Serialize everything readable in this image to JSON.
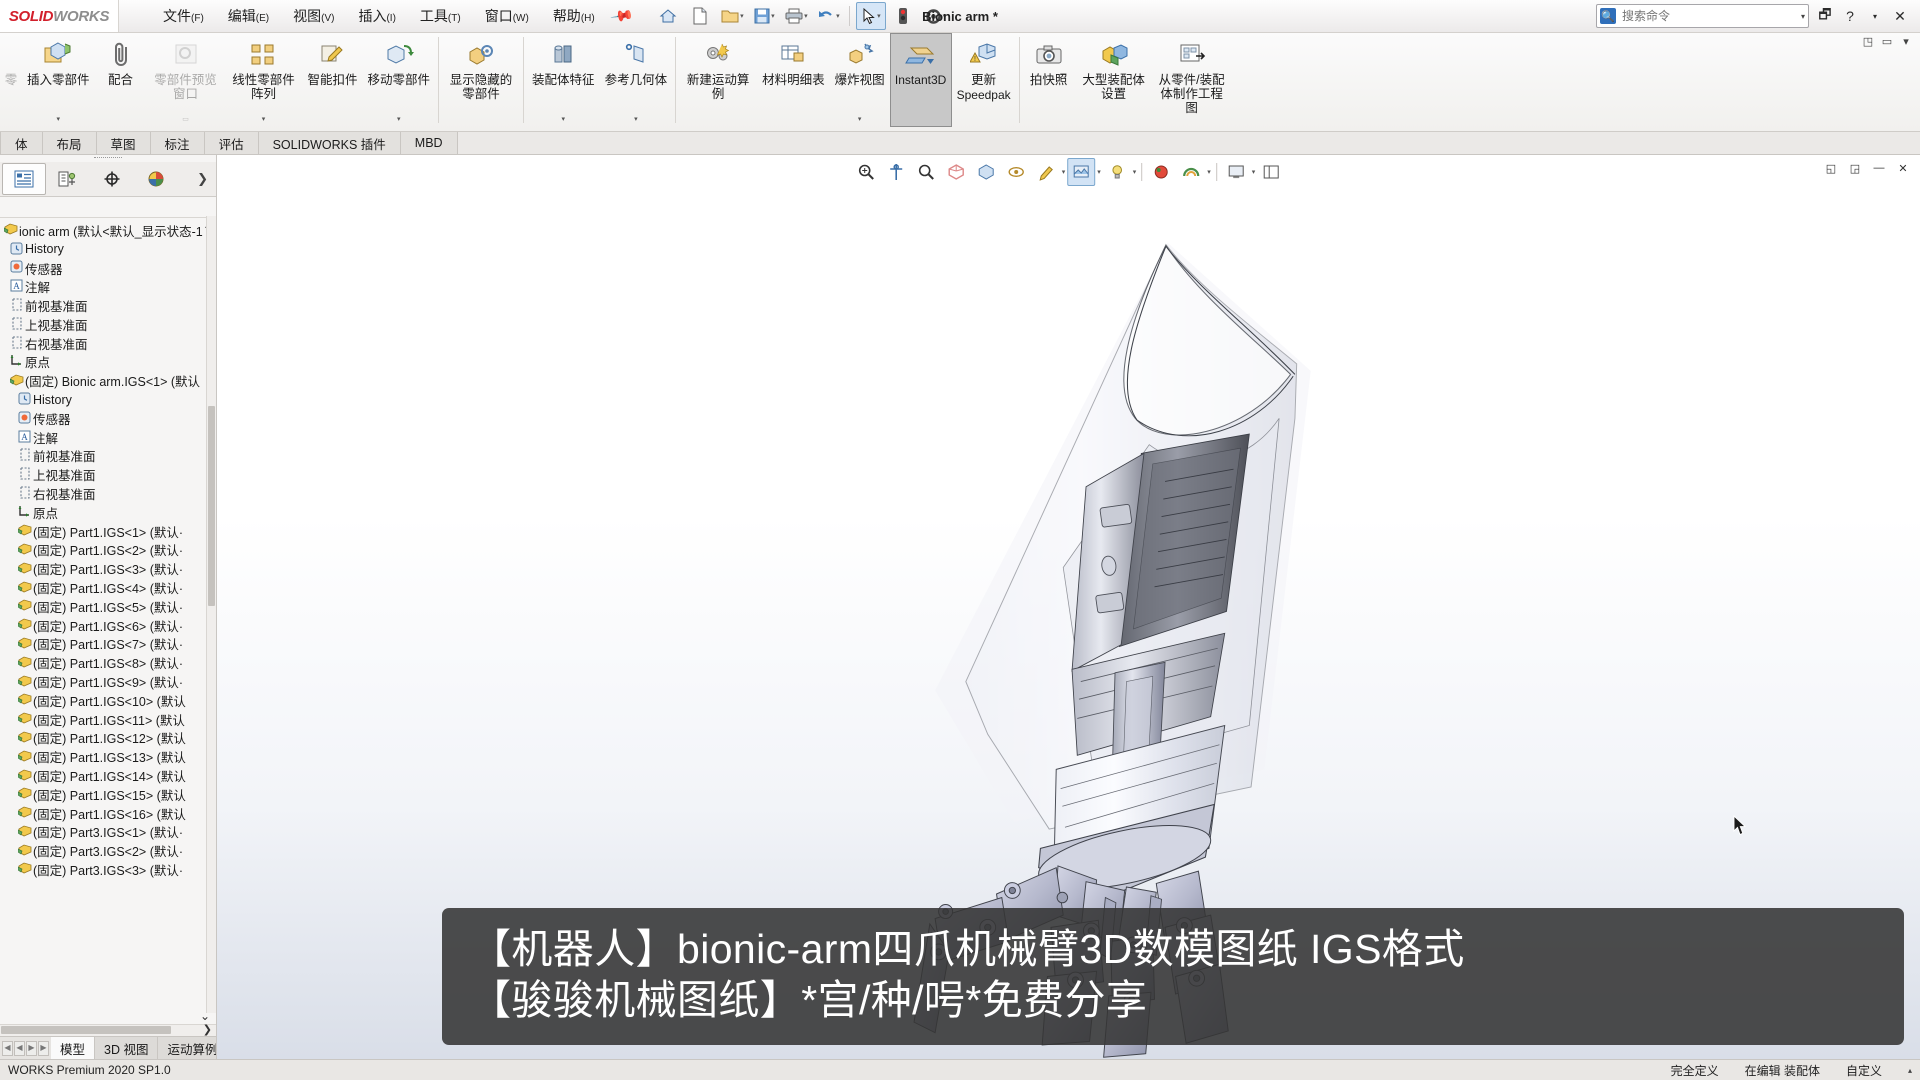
{
  "titlebar": {
    "logo_primary": "SOLID",
    "logo_secondary": "WORKS",
    "document_title": "Bionic arm *",
    "menus": [
      {
        "label": "文件",
        "mn": "(F)"
      },
      {
        "label": "编辑",
        "mn": "(E)"
      },
      {
        "label": "视图",
        "mn": "(V)"
      },
      {
        "label": "插入",
        "mn": "(I)"
      },
      {
        "label": "工具",
        "mn": "(T)"
      },
      {
        "label": "窗口",
        "mn": "(W)"
      },
      {
        "label": "帮助",
        "mn": "(H)"
      }
    ],
    "quick_tools": [
      {
        "name": "home-icon",
        "glyph": "⌂"
      },
      {
        "name": "new-document-icon",
        "glyph": "🗋"
      },
      {
        "name": "open-document-icon",
        "glyph": "📂"
      },
      {
        "name": "save-icon",
        "glyph": "💾"
      },
      {
        "name": "print-icon",
        "glyph": "🖨"
      },
      {
        "name": "undo-icon",
        "glyph": "↩"
      },
      {
        "name": "select-icon",
        "glyph": "⬉"
      },
      {
        "name": "rebuild-icon",
        "glyph": "🚦"
      },
      {
        "name": "options-icon",
        "glyph": "⚙"
      }
    ],
    "search_placeholder": "搜索命令",
    "search_value": "",
    "help_buttons": [
      "🗔",
      "?",
      "✕"
    ],
    "window_controls": [
      "—",
      "◻",
      "✕"
    ]
  },
  "ribbon": {
    "items": [
      {
        "name": "insert-component",
        "label": "插入零部件",
        "icon": "📥",
        "dropdown": true,
        "state": "normal"
      },
      {
        "name": "mate",
        "label": "配合",
        "icon": "🖇",
        "dropdown": false,
        "state": "normal"
      },
      {
        "name": "component-preview",
        "label": "零部件预览窗口",
        "icon": "🔍",
        "dropdown": false,
        "state": "disabled"
      },
      {
        "name": "linear-component-pattern",
        "label": "线性零部件阵列",
        "icon": "⠿",
        "dropdown": true,
        "state": "normal"
      },
      {
        "name": "smart-fasteners",
        "label": "智能扣件",
        "icon": "🔩",
        "dropdown": false,
        "state": "normal"
      },
      {
        "name": "move-component",
        "label": "移动零部件",
        "icon": "📦",
        "dropdown": true,
        "state": "normal"
      },
      {
        "name": "show-hidden-components",
        "label": "显示隐藏的零部件",
        "icon": "👁",
        "dropdown": false,
        "state": "normal"
      },
      {
        "name": "assembly-features",
        "label": "装配体特征",
        "icon": "🗜",
        "dropdown": true,
        "state": "normal"
      },
      {
        "name": "reference-geometry",
        "label": "参考几何体",
        "icon": "📐",
        "dropdown": true,
        "state": "normal"
      },
      {
        "name": "new-motion-study",
        "label": "新建运动算例",
        "icon": "⚙",
        "dropdown": false,
        "state": "normal"
      },
      {
        "name": "bill-of-materials",
        "label": "材料明细表",
        "icon": "📋",
        "dropdown": false,
        "state": "normal"
      },
      {
        "name": "exploded-view",
        "label": "爆炸视图",
        "icon": "💥",
        "dropdown": true,
        "state": "normal"
      },
      {
        "name": "instant3d",
        "label": "Instant3D",
        "icon": "📏",
        "dropdown": false,
        "state": "active",
        "latin": true
      },
      {
        "name": "update-speedpak",
        "label": "更新\nSpeedpak",
        "label_line1": "更新",
        "label_line2": "Speedpak",
        "icon": "🧊",
        "dropdown": false,
        "state": "normal"
      },
      {
        "name": "take-snapshot",
        "label": "拍快照",
        "icon": "📷",
        "dropdown": false,
        "state": "normal"
      },
      {
        "name": "large-assembly-settings",
        "label": "大型装配体设置",
        "icon": "🟨",
        "dropdown": false,
        "state": "normal"
      },
      {
        "name": "make-drawing-from-part-assembly",
        "label": "从零件/装配体制作工程图",
        "icon": "📄",
        "dropdown": false,
        "state": "normal"
      }
    ],
    "collapse_controls": [
      "◳",
      "▭",
      "▾"
    ]
  },
  "tabs": [
    {
      "name": "tab-assembly",
      "label": "体",
      "selected": false
    },
    {
      "name": "tab-layout",
      "label": "布局",
      "selected": false
    },
    {
      "name": "tab-sketch",
      "label": "草图",
      "selected": false
    },
    {
      "name": "tab-markup",
      "label": "标注",
      "selected": false
    },
    {
      "name": "tab-evaluate",
      "label": "评估",
      "selected": false
    },
    {
      "name": "tab-solidworks-addins",
      "label": "SOLIDWORKS 插件",
      "selected": false
    },
    {
      "name": "tab-mbd",
      "label": "MBD",
      "selected": false
    }
  ],
  "feature_manager": {
    "panel_tabs": [
      {
        "name": "feature-tree-tab",
        "glyph": "▤",
        "selected": true
      },
      {
        "name": "property-manager-tab",
        "glyph": "⊞",
        "selected": false
      },
      {
        "name": "configuration-manager-tab",
        "glyph": "⊕",
        "selected": false
      },
      {
        "name": "display-manager-tab",
        "glyph": "◕",
        "selected": false
      }
    ],
    "expand_arrow": "❯",
    "tree": [
      {
        "label": "ionic arm  (默认<默认_显示状态-1",
        "icon": "🟡",
        "depth": 0,
        "name": "tree-root-assembly"
      },
      {
        "label": "History",
        "icon": "🕘",
        "depth": 1,
        "name": "tree-item-history"
      },
      {
        "label": "传感器",
        "icon": "🔘",
        "depth": 1,
        "name": "tree-item-sensors"
      },
      {
        "label": "注解",
        "icon": "🅰",
        "depth": 1,
        "name": "tree-item-annotations"
      },
      {
        "label": "前视基准面",
        "icon": "▱",
        "depth": 1,
        "name": "tree-item-front-plane"
      },
      {
        "label": "上视基准面",
        "icon": "▱",
        "depth": 1,
        "name": "tree-item-top-plane"
      },
      {
        "label": "右视基准面",
        "icon": "▱",
        "depth": 1,
        "name": "tree-item-right-plane"
      },
      {
        "label": "原点",
        "icon": "⌞",
        "depth": 1,
        "name": "tree-item-origin"
      },
      {
        "label": "(固定) Bionic arm.IGS<1> (默认",
        "icon": "🟡",
        "depth": 1,
        "name": "tree-item-bionic-arm-igs"
      },
      {
        "label": "History",
        "icon": "🕘",
        "depth": 2,
        "name": "tree-item-history-2"
      },
      {
        "label": "传感器",
        "icon": "🔘",
        "depth": 2,
        "name": "tree-item-sensors-2"
      },
      {
        "label": "注解",
        "icon": "🅰",
        "depth": 2,
        "name": "tree-item-annotations-2"
      },
      {
        "label": "前视基准面",
        "icon": "▱",
        "depth": 2,
        "name": "tree-item-front-plane-2"
      },
      {
        "label": "上视基准面",
        "icon": "▱",
        "depth": 2,
        "name": "tree-item-top-plane-2"
      },
      {
        "label": "右视基准面",
        "icon": "▱",
        "depth": 2,
        "name": "tree-item-right-plane-2"
      },
      {
        "label": "原点",
        "icon": "⌞",
        "depth": 2,
        "name": "tree-item-origin-2"
      },
      {
        "label": "(固定) Part1.IGS<1> (默认·",
        "icon": "🟨",
        "depth": 2,
        "name": "tree-item-part1-1"
      },
      {
        "label": "(固定) Part1.IGS<2> (默认·",
        "icon": "🟨",
        "depth": 2,
        "name": "tree-item-part1-2"
      },
      {
        "label": "(固定) Part1.IGS<3> (默认·",
        "icon": "🟨",
        "depth": 2,
        "name": "tree-item-part1-3"
      },
      {
        "label": "(固定) Part1.IGS<4> (默认·",
        "icon": "🟨",
        "depth": 2,
        "name": "tree-item-part1-4"
      },
      {
        "label": "(固定) Part1.IGS<5> (默认·",
        "icon": "🟨",
        "depth": 2,
        "name": "tree-item-part1-5"
      },
      {
        "label": "(固定) Part1.IGS<6> (默认·",
        "icon": "🟨",
        "depth": 2,
        "name": "tree-item-part1-6"
      },
      {
        "label": "(固定) Part1.IGS<7> (默认·",
        "icon": "🟨",
        "depth": 2,
        "name": "tree-item-part1-7"
      },
      {
        "label": "(固定) Part1.IGS<8> (默认·",
        "icon": "🟨",
        "depth": 2,
        "name": "tree-item-part1-8"
      },
      {
        "label": "(固定) Part1.IGS<9> (默认·",
        "icon": "🟨",
        "depth": 2,
        "name": "tree-item-part1-9"
      },
      {
        "label": "(固定) Part1.IGS<10> (默认",
        "icon": "🟨",
        "depth": 2,
        "name": "tree-item-part1-10"
      },
      {
        "label": "(固定) Part1.IGS<11> (默认",
        "icon": "🟨",
        "depth": 2,
        "name": "tree-item-part1-11"
      },
      {
        "label": "(固定) Part1.IGS<12> (默认",
        "icon": "🟨",
        "depth": 2,
        "name": "tree-item-part1-12"
      },
      {
        "label": "(固定) Part1.IGS<13> (默认",
        "icon": "🟨",
        "depth": 2,
        "name": "tree-item-part1-13"
      },
      {
        "label": "(固定) Part1.IGS<14> (默认",
        "icon": "🟨",
        "depth": 2,
        "name": "tree-item-part1-14"
      },
      {
        "label": "(固定) Part1.IGS<15> (默认",
        "icon": "🟨",
        "depth": 2,
        "name": "tree-item-part1-15"
      },
      {
        "label": "(固定) Part1.IGS<16> (默认",
        "icon": "🟨",
        "depth": 2,
        "name": "tree-item-part1-16"
      },
      {
        "label": "(固定) Part3.IGS<1> (默认·",
        "icon": "🟨",
        "depth": 2,
        "name": "tree-item-part3-1"
      },
      {
        "label": "(固定) Part3.IGS<2> (默认·",
        "icon": "🟨",
        "depth": 2,
        "name": "tree-item-part3-2"
      },
      {
        "label": "(固定) Part3.IGS<3> (默认·",
        "icon": "🟨",
        "depth": 2,
        "name": "tree-item-part3-3"
      }
    ],
    "bottom_tabs": [
      {
        "name": "bottom-tab-model",
        "label": "模型",
        "selected": true
      },
      {
        "name": "bottom-tab-3dviews",
        "label": "3D 视图",
        "selected": false
      },
      {
        "name": "bottom-tab-motion-study",
        "label": "运动算例",
        "selected": false
      }
    ]
  },
  "view_toolbar": {
    "buttons": [
      {
        "name": "zoom-to-fit-icon",
        "glyph": "🔍",
        "dropdown": false,
        "selected": false
      },
      {
        "name": "section-view-icon",
        "glyph": "⚓",
        "dropdown": false,
        "selected": false
      },
      {
        "name": "zoom-to-area-icon",
        "glyph": "🔎",
        "dropdown": false,
        "selected": false
      },
      {
        "name": "view-orientation-icon",
        "glyph": "◈",
        "dropdown": false,
        "selected": false
      },
      {
        "name": "display-style-icon",
        "glyph": "🧊",
        "dropdown": false,
        "selected": false
      },
      {
        "name": "hide-show-items-icon",
        "glyph": "👓",
        "dropdown": false,
        "selected": false
      },
      {
        "name": "edit-appearance-icon",
        "glyph": "🎨",
        "dropdown": true,
        "selected": false
      },
      {
        "name": "apply-scene-icon",
        "glyph": "🖼",
        "dropdown": true,
        "selected": true
      },
      {
        "name": "view-settings-icon",
        "glyph": "💡",
        "dropdown": true,
        "selected": false
      },
      {
        "name": "color-icon",
        "glyph": "🔴",
        "dropdown": false,
        "selected": false
      },
      {
        "name": "render-tools-icon",
        "glyph": "🌈",
        "dropdown": true,
        "selected": false
      },
      {
        "name": "viewport-icon",
        "glyph": "🖥",
        "dropdown": true,
        "selected": false
      },
      {
        "name": "display-pane-icon",
        "glyph": "▤",
        "dropdown": false,
        "selected": false
      }
    ],
    "window_controls": [
      "◱",
      "◲",
      "—",
      "✕"
    ]
  },
  "caption": {
    "line1": "【机器人】bionic-arm四爪机械臂3D数模图纸 IGS格式",
    "line2": "【骏骏机械图纸】*宫/种/呺*免费分享"
  },
  "statusbar": {
    "left": "WORKS Premium 2020 SP1.0",
    "items": [
      "完全定义",
      "在编辑 装配体",
      "自定义"
    ],
    "arrow": "▴"
  }
}
